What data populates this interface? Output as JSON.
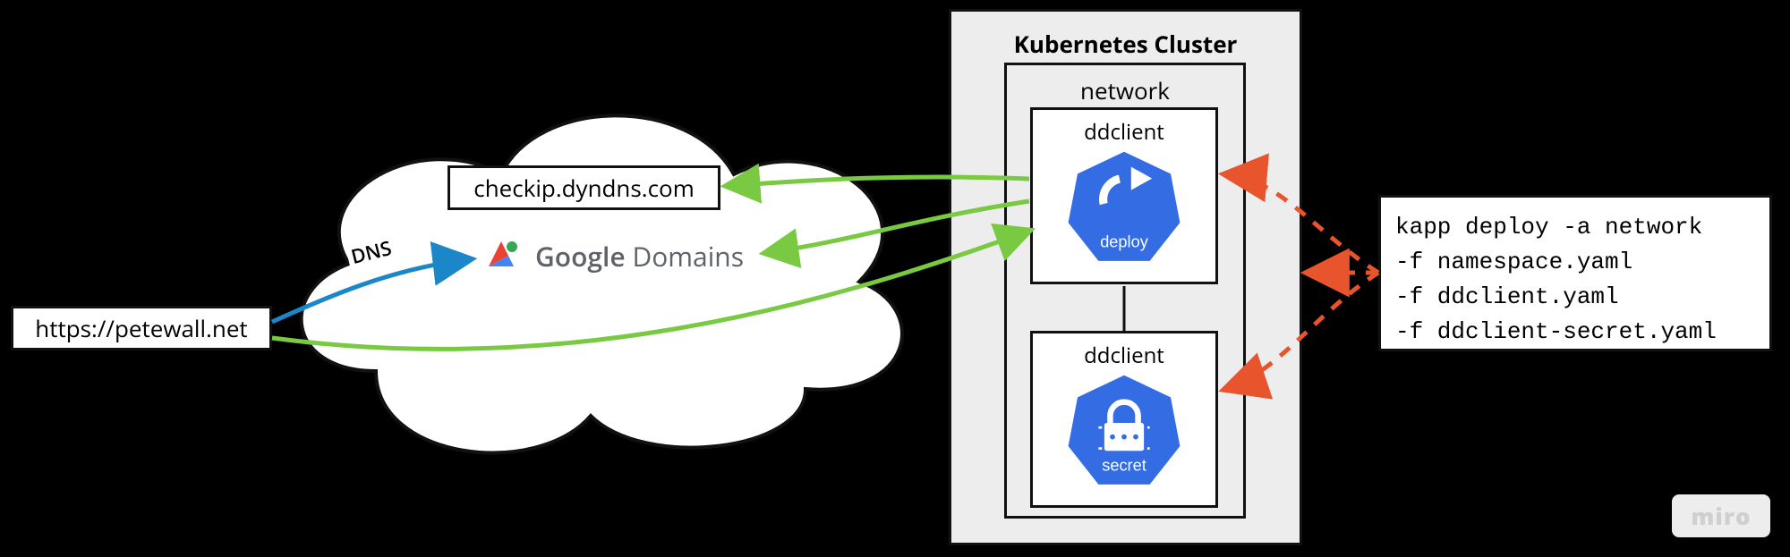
{
  "url_label": "https://petewall.net",
  "dns_label": "DNS",
  "checkip_label": "checkip.dyndns.com",
  "google_domains": {
    "brand": "Google",
    "product": "Domains"
  },
  "cluster": {
    "title": "Kubernetes Cluster",
    "network_label": "network",
    "pods": {
      "deploy": {
        "name": "ddclient",
        "kind": "deploy"
      },
      "secret": {
        "name": "ddclient",
        "kind": "secret"
      }
    }
  },
  "command": {
    "line1": "kapp deploy -a network",
    "line2": "-f namespace.yaml",
    "line3": "-f ddclient.yaml",
    "line4": "-f ddclient-secret.yaml"
  },
  "miro_label": "miro",
  "colors": {
    "green": "#79c943",
    "blue_dns": "#1b87c9",
    "orange": "#e8552d",
    "k8s_blue": "#346ce4",
    "grey_text": "#5f6368"
  }
}
